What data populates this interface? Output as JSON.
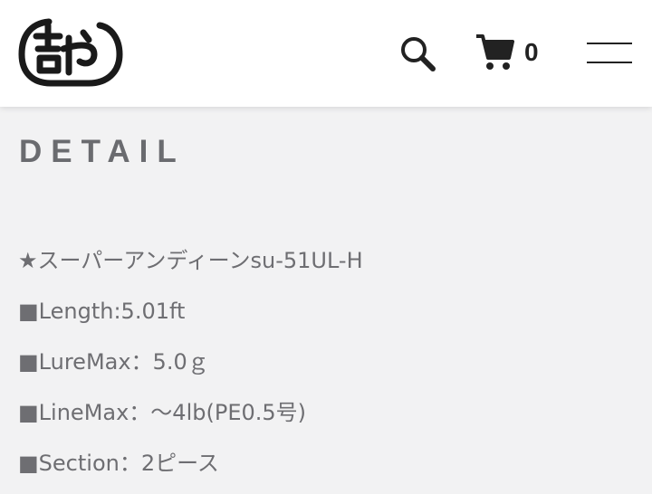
{
  "header": {
    "logo_alt": "吉や",
    "cart_count": "0"
  },
  "icons": {
    "logo": "yoshiya-logo",
    "search": "search-icon",
    "cart": "cart-icon",
    "menu": "hamburger-menu-icon"
  },
  "colors": {
    "background": "#f2f2f3",
    "header_bg": "#ffffff",
    "title": "#6a6b6f",
    "text": "#6e6e72",
    "icon": "#222222"
  },
  "detail": {
    "title": "DETAIL",
    "items": [
      "★スーパーアンディーンsu-51UL-H",
      "■Length:5.01ft",
      "■LureMax：5.0ｇ",
      "■LineMax：～4lb(PE0.5号)",
      "■Section：2ピース"
    ]
  }
}
